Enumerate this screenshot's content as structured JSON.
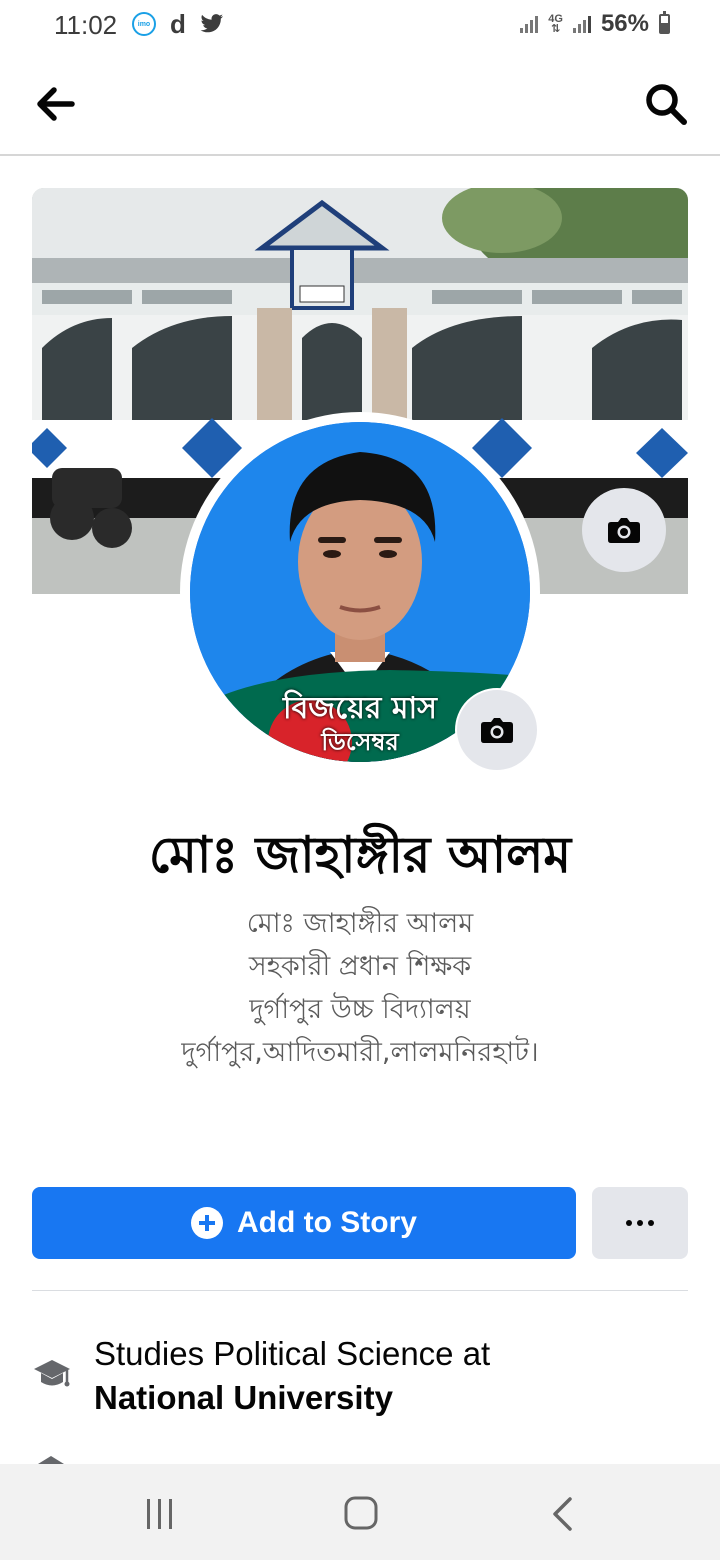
{
  "status_bar": {
    "time": "11:02",
    "imo_label": "imo",
    "d_label": "d",
    "network_label_top": "4G",
    "network_label_bottom": "⇅",
    "battery": "56%"
  },
  "header": {
    "back_icon": "arrow-left-icon",
    "search_icon": "search-icon"
  },
  "profile": {
    "frame_text_line1": "বিজয়ের মাস",
    "frame_text_line2": "ডিসেম্বর",
    "name": "মোঃ জাহাঙ্গীর আলম",
    "bio": [
      "মোঃ জাহাঙ্গীর আলম",
      "সহকারী প্রধান শিক্ষক",
      "দুর্গাপুর উচ্চ বিদ্যালয়",
      "দুর্গাপুর,আদিতমারী,লালমনিরহাট।"
    ]
  },
  "actions": {
    "add_story_label": "Add to Story",
    "more_icon": "more-dots-icon"
  },
  "details": {
    "education_prefix": "Studies Political Science at",
    "education_school": "National University",
    "education_icon": "graduation-cap-icon"
  },
  "colors": {
    "primary": "#1877f2",
    "secondary_button": "#e4e6eb",
    "text": "#050505",
    "muted_text": "#5b5b5b"
  }
}
